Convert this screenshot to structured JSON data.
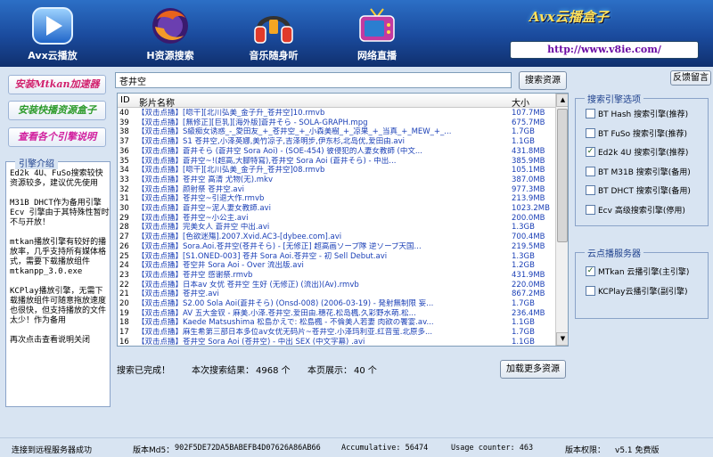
{
  "header": {
    "nav": [
      {
        "label": "Avx云播放",
        "icon": "play-icon"
      },
      {
        "label": "H资源搜索",
        "icon": "firefox-icon"
      },
      {
        "label": "音乐随身听",
        "icon": "headphones-icon"
      },
      {
        "label": "网络直播",
        "icon": "tv-icon"
      }
    ],
    "logo_title": "Avx云播盒子",
    "logo_url": "http://www.v8ie.com/"
  },
  "left": {
    "buttons": [
      "安装Mtkan加速器",
      "安装快播资源盒子",
      "查看各个引擎说明"
    ],
    "info_title": "引擎介绍",
    "info_text": "Ed2k 4U、FuSo搜索较快资源较多，建议优先使用\n\nM31B DHCT作为备用引擎Ecv 引擎由于其特殊性暂时不与开放！\n\nmtkan播放引擎有较好的播放率，几乎支持所有媒体格式，需要下载播放组件mtkanpp_3.0.exe\n\nKCPlay播放引擎，无需下载播放组件可随意拖放速度也很快，但支持播放的文件太少！作为备用\n\n再次点击查看说明关闭"
  },
  "search": {
    "query": "苍井空",
    "search_button": "搜索资源",
    "feedback_button": "反馈留言",
    "load_more_button": "加载更多资源"
  },
  "table": {
    "headers": {
      "id": "ID",
      "name": "影片名称",
      "size": "大小"
    },
    "rows": [
      {
        "id": "40",
        "name": "【双击点播】[唿干][北川弘美_金子升_苍井空]10.rmvb",
        "size": "107.7MB"
      },
      {
        "id": "39",
        "name": "【双击点播】[無修正][巨乳][海外版]蒼井そら - SOLA-GRAPH.mpg",
        "size": "675.7MB"
      },
      {
        "id": "38",
        "name": "【双击点播】S級痴女诱惑_-_愛田友_+_苍井空_+_小森美樹_+_凉果_+_当真_+_MEW_+_...",
        "size": "1.7GB"
      },
      {
        "id": "37",
        "name": "【双击点播】S1 苍井空,小泽英娜,美竹凉子,吉泽明步,伊东杉,北岛优,爱田由.avi",
        "size": "1.1GB"
      },
      {
        "id": "36",
        "name": "【双击点播】蒼井そら (蒼井空 Sora Aoi) - (SOE-454) 彼侵犯的人妻女教師 (中文...",
        "size": "431.8MB"
      },
      {
        "id": "35",
        "name": "【双击点播】蒼井空~!(超高,大腳特寫),苍井空 Sora Aoi (蒼井そら) - 中出...",
        "size": "385.9MB"
      },
      {
        "id": "34",
        "name": "【双击点播】[唿干][北川弘美_金子升_苍井空]08.rmvb",
        "size": "105.1MB"
      },
      {
        "id": "33",
        "name": "【双击点播】苍井空 高清 尤物(无).mkv",
        "size": "387.0MB"
      },
      {
        "id": "32",
        "name": "【双击点播】颜射祭 苍井空.avi",
        "size": "977.3MB"
      },
      {
        "id": "31",
        "name": "【双击点播】苍井空~引退大作.rmvb",
        "size": "213.9MB"
      },
      {
        "id": "30",
        "name": "【双击点播】蒼井空~泥人妻女教師.avi",
        "size": "1023.2MB"
      },
      {
        "id": "29",
        "name": "【双击点播】苍井空~小公主.avi",
        "size": "200.0MB"
      },
      {
        "id": "28",
        "name": "【双击点播】完美女人 蒼井空 中出.avi",
        "size": "1.3GB"
      },
      {
        "id": "27",
        "name": "【双击点播】[色欲迷殤].2007.Xvid.AC3-[dybee.com].avi",
        "size": "700.4MB"
      },
      {
        "id": "26",
        "name": "【双击点播】Sora.Aoi.苍井空(苍井そら) - [无修正] 超高画ソープ隊 逆ソープ天国...",
        "size": "219.5MB"
      },
      {
        "id": "25",
        "name": "【双击点播】[S1.ONED-003] 苍井 Sora Aoi.苍井空 - 初 Sell Debut.avi",
        "size": "1.3GB"
      },
      {
        "id": "24",
        "name": "【双击点播】苍空井 Sora Aoi - Over 流出版.avi",
        "size": "1.2GB"
      },
      {
        "id": "23",
        "name": "【双击点播】苍井空 感谢祭.rmvb",
        "size": "431.9MB"
      },
      {
        "id": "22",
        "name": "【双击点播】日本av 女优 苍井空 生好 (无修正) (流出)(Av).rmvb",
        "size": "220.0MB"
      },
      {
        "id": "21",
        "name": "【双击点播】苍井空.avi",
        "size": "867.2MB"
      },
      {
        "id": "20",
        "name": "【双击点播】S2.00 Sola Aoi(蒼井そら) (Onsd-008) (2006-03-19) - 発射無制限 妄...",
        "size": "1.7GB"
      },
      {
        "id": "19",
        "name": "【双击点播】AV 五大金钗 - 麻美.小泽.苍井空.爱田由.穗花.松岛楓.久彩野水萌.松...",
        "size": "236.4MB"
      },
      {
        "id": "18",
        "name": "【双击点播】Kaede Matsushima 松島かえで: 松島楓 - 不倫美人若妻 肉欲の饗宴.av...",
        "size": "1.1GB"
      },
      {
        "id": "17",
        "name": "【双击点播】麻生希第三部日本多位av女优无码片~苍井空.小泽玛利亚.红音萤.北原多...",
        "size": "1.7GB"
      },
      {
        "id": "16",
        "name": "【双击点播】苍井空 Sora Aoi (苍井空) - 中出 SEX (中文字幕) .avi",
        "size": "1.1GB"
      }
    ]
  },
  "status": {
    "done": "搜索已完成！",
    "result_label": "本次搜索结果：",
    "result_count": "4968 个",
    "shown_label": "本页展示：",
    "shown_count": "40 个"
  },
  "right": {
    "engines_title": "搜索引擎选项",
    "engines": [
      {
        "label": "BT Hash 搜索引擎(推荐)",
        "checked": false
      },
      {
        "label": "BT FuSo 搜索引擎(推荐)",
        "checked": false
      },
      {
        "label": "Ed2k 4U 搜索引擎(推荐)",
        "checked": true
      },
      {
        "label": "BT M31B 搜索引擎(备用)",
        "checked": false
      },
      {
        "label": "BT DHCT 搜索引擎(备用)",
        "checked": false
      },
      {
        "label": "Ecv 高级搜索引擎(停用)",
        "checked": false
      }
    ],
    "servers_title": "云点播服务器",
    "servers": [
      {
        "label": "MTkan 云播引擎(主引擎)",
        "checked": true
      },
      {
        "label": "KCPlay云播引擎(副引擎)",
        "checked": false
      }
    ]
  },
  "footer": {
    "connection": "连接到远程服务器成功",
    "md5_label": "版本Md5：",
    "md5": "902F5DE72DA5BABEFB4D07626A86AB66",
    "accumulative": "Accumulative: 56474",
    "usage": "Usage counter: 463",
    "version_label": "版本权限：",
    "version": "v5.1 免费版"
  }
}
